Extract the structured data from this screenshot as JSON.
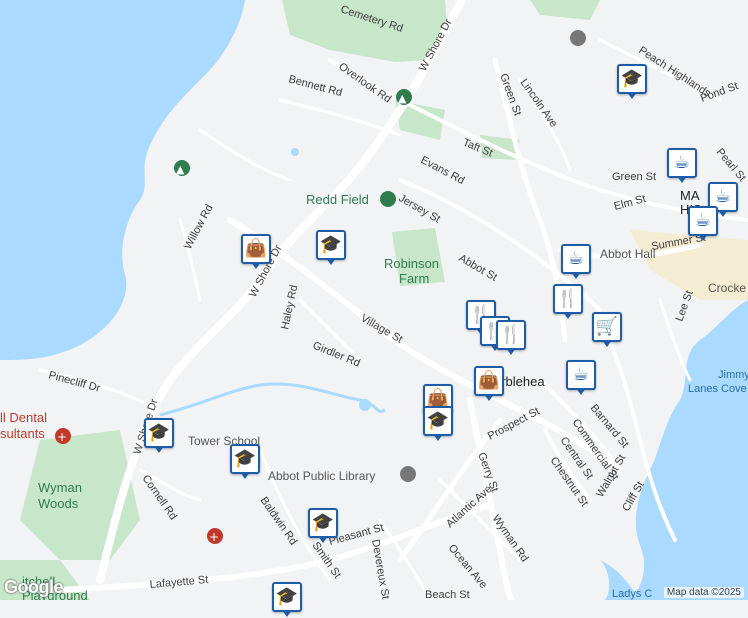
{
  "map": {
    "streets": [
      "Cemetery Rd",
      "W Shore Dr",
      "Bennett Rd",
      "Overlook Rd",
      "Green St",
      "Lincoln Ave",
      "Peach Highlands",
      "Pond St",
      "Taft St",
      "Evans Rd",
      "Green St",
      "Pearl St",
      "Jersey St",
      "Elm St",
      "Willow Rd",
      "W Shore Dr",
      "Abbot St",
      "Summer St",
      "Haley Rd",
      "Village St",
      "Lee St",
      "Girdler Rd",
      "Pinecliff Dr",
      "W Shore Dr",
      "Cornell Rd",
      "Prospect St",
      "Barnard St",
      "Commercial St",
      "Central St",
      "Chestnut St",
      "Walnut St",
      "Cliff St",
      "Gerry St",
      "Atlantic Ave",
      "Wyman Rd",
      "Baldwin Rd",
      "Smith St",
      "Pleasant St",
      "Devereux St",
      "Ocean Ave",
      "Lafayette St",
      "Beach St"
    ],
    "places": {
      "redd_field": "Redd Field",
      "robinson_farm_1": "Robinson",
      "robinson_farm_2": "Farm",
      "abbot_hall": "Abbot Hall",
      "abbot_library": "Abbot Public Library",
      "tower_school": "Tower School",
      "dental_1": "ll Dental",
      "dental_2": "sultants",
      "wyman_woods_1": "Wyman",
      "wyman_woods_2": "Woods",
      "crocker": "Crocke",
      "jimmy_cove_1": "Jimmy",
      "jimmy_cove_2": "Lanes Cove",
      "marblehead": "arblehea",
      "ma_historic_1": "MA",
      "ma_historic_2": "HIS",
      "ladys_cove": "Ladys C",
      "mitchell_1": "itchell",
      "mitchell_2": "Playground"
    },
    "attribution": "Map data ©2025",
    "logo": "Google"
  },
  "colors": {
    "water": "#aadaff",
    "park": "#c8e6c9",
    "road": "#ffffff",
    "marker": "#1f5ca8"
  },
  "markers": [
    {
      "icon": "school",
      "glyph": "🎓"
    },
    {
      "icon": "coffee",
      "glyph": "☕"
    },
    {
      "icon": "coffee",
      "glyph": "☕"
    },
    {
      "icon": "coffee",
      "glyph": "☕"
    },
    {
      "icon": "shopping-bag",
      "glyph": "👜"
    },
    {
      "icon": "school",
      "glyph": "🎓"
    },
    {
      "icon": "coffee",
      "glyph": "☕"
    },
    {
      "icon": "restaurant",
      "glyph": "🍴"
    },
    {
      "icon": "restaurant",
      "glyph": "🍴"
    },
    {
      "icon": "restaurant",
      "glyph": "🍴"
    },
    {
      "icon": "restaurant",
      "glyph": "🍴"
    },
    {
      "icon": "shopping-cart",
      "glyph": "🛒"
    },
    {
      "icon": "shopping-bag",
      "glyph": "👜"
    },
    {
      "icon": "coffee",
      "glyph": "☕"
    },
    {
      "icon": "shopping-bag",
      "glyph": "👜"
    },
    {
      "icon": "school",
      "glyph": "🎓"
    },
    {
      "icon": "school",
      "glyph": "🎓"
    },
    {
      "icon": "school",
      "glyph": "🎓"
    },
    {
      "icon": "school",
      "glyph": "🎓"
    },
    {
      "icon": "school",
      "glyph": "🎓"
    }
  ]
}
